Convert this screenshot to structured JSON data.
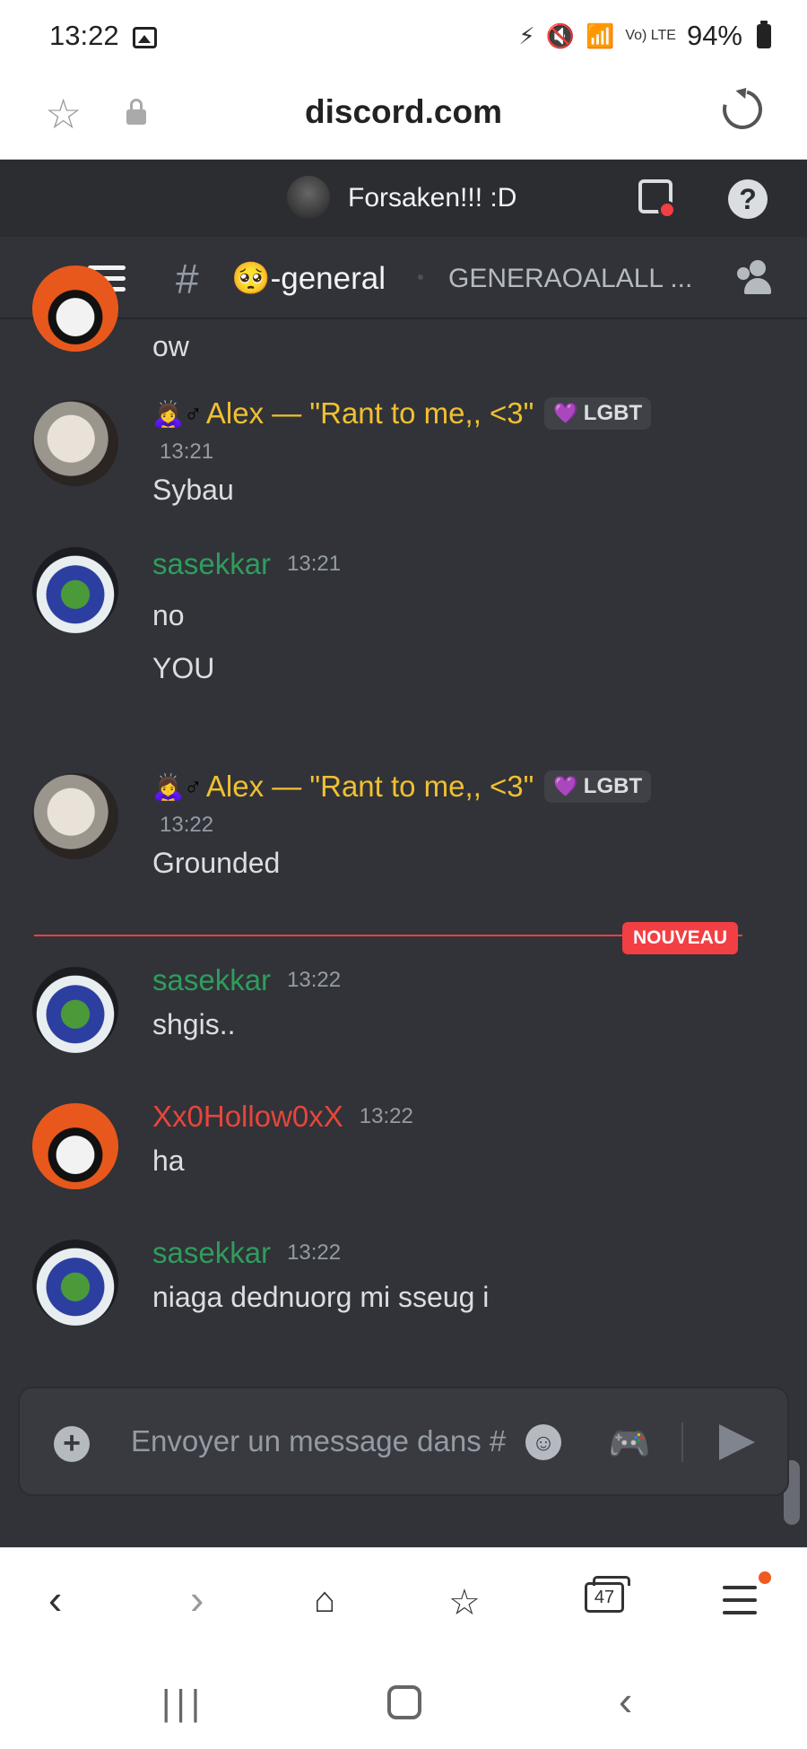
{
  "statusbar": {
    "time": "13:22",
    "battery": "94%",
    "network": "Vo) LTE"
  },
  "browser": {
    "domain": "discord.com",
    "tab_count": "47"
  },
  "server": {
    "name": "Forsaken!!! :D"
  },
  "channel": {
    "name": "🥺-general",
    "topic": "GENERAOALALL ..."
  },
  "messages": [
    {
      "username": "",
      "text": "ow",
      "name_color": ""
    },
    {
      "username": "Alex — \"Rant to me,, <3\"",
      "prefix": "🙇‍♀️♂",
      "timestamp": "13:21",
      "text": "Sybau",
      "badge": "LGBT",
      "name_color": "#f0c030"
    },
    {
      "username": "sasekkar",
      "timestamp": "13:21",
      "lines": [
        "no",
        "YOU"
      ],
      "name_color": "#2f9d5c"
    },
    {
      "username": "Alex — \"Rant to me,, <3\"",
      "prefix": "🙇‍♀️♂",
      "timestamp": "13:22",
      "text": "Grounded",
      "badge": "LGBT",
      "name_color": "#f0c030"
    },
    {
      "username": "sasekkar",
      "timestamp": "13:22",
      "text": "shgis..",
      "name_color": "#2f9d5c"
    },
    {
      "username": "Xx0Hollow0xX",
      "timestamp": "13:22",
      "text": "ha",
      "name_color": "#e8453c"
    },
    {
      "username": "sasekkar",
      "timestamp": "13:22",
      "text": "niaga dednuorg mi sseug i",
      "name_color": "#2f9d5c"
    }
  ],
  "new_divider": {
    "label": "NOUVEAU"
  },
  "composer": {
    "placeholder": "Envoyer un message dans #"
  },
  "colors": {
    "bg": "#313338",
    "header": "#2b2d31",
    "accent_red": "#f23f43"
  },
  "icons": [
    "star-icon",
    "lock-icon",
    "reload-icon",
    "inbox-icon",
    "help-icon",
    "hamburger-icon",
    "hash-icon",
    "members-icon",
    "plus-icon",
    "emoji-icon",
    "gamepad-icon",
    "send-icon",
    "back-icon",
    "forward-icon",
    "home-icon",
    "bookmarks-icon",
    "tabs-icon",
    "menu-icon"
  ]
}
